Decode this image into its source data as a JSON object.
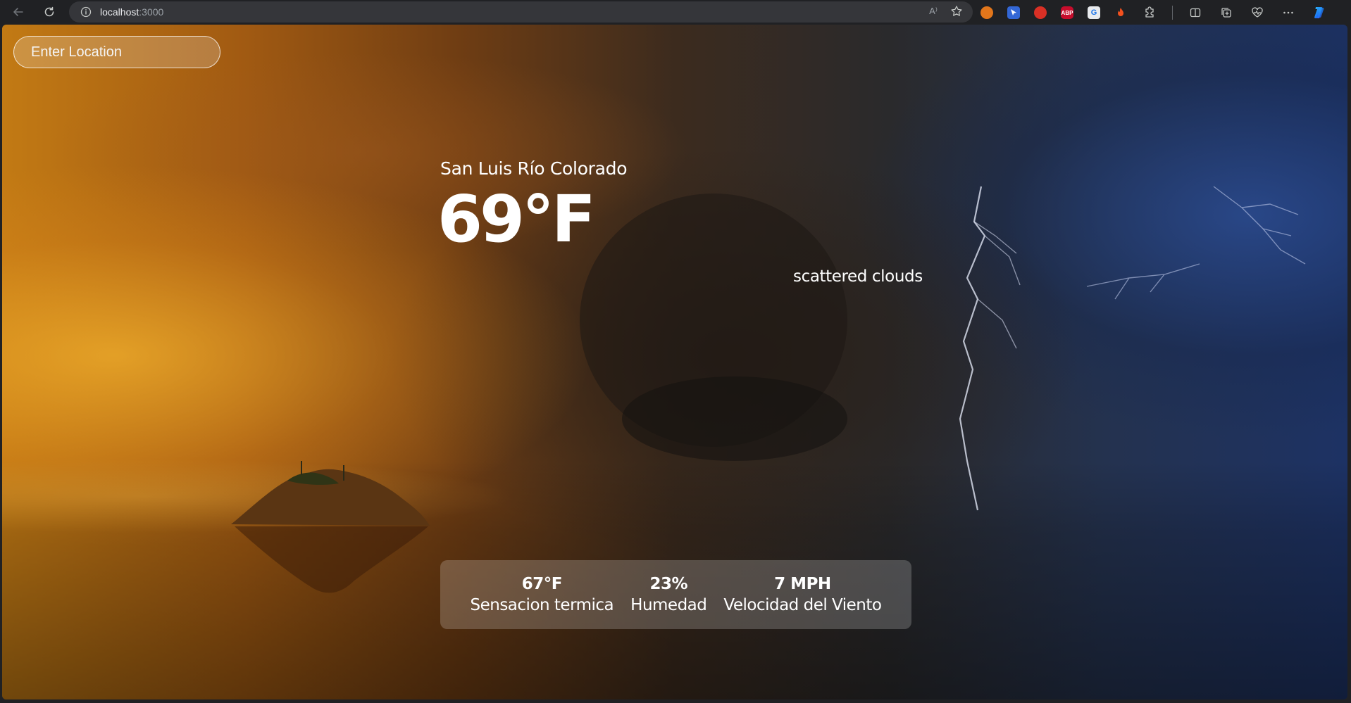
{
  "browser": {
    "url_host": "localhost",
    "url_port": ":3000",
    "read_aloud_label": "A⁾"
  },
  "search": {
    "placeholder": "Enter Location",
    "value": ""
  },
  "weather": {
    "city": "San Luis Río Colorado",
    "temperature": "69°F",
    "description": "scattered clouds",
    "feels_like": {
      "value": "67°F",
      "label": "Sensacion termica"
    },
    "humidity": {
      "value": "23%",
      "label": "Humedad"
    },
    "wind": {
      "value": "7 MPH",
      "label": "Velocidad del Viento"
    }
  },
  "colors": {
    "sunset_orange": "#c27a14",
    "storm_blue": "#1d3264",
    "panel_tint": "#8a4a44"
  }
}
